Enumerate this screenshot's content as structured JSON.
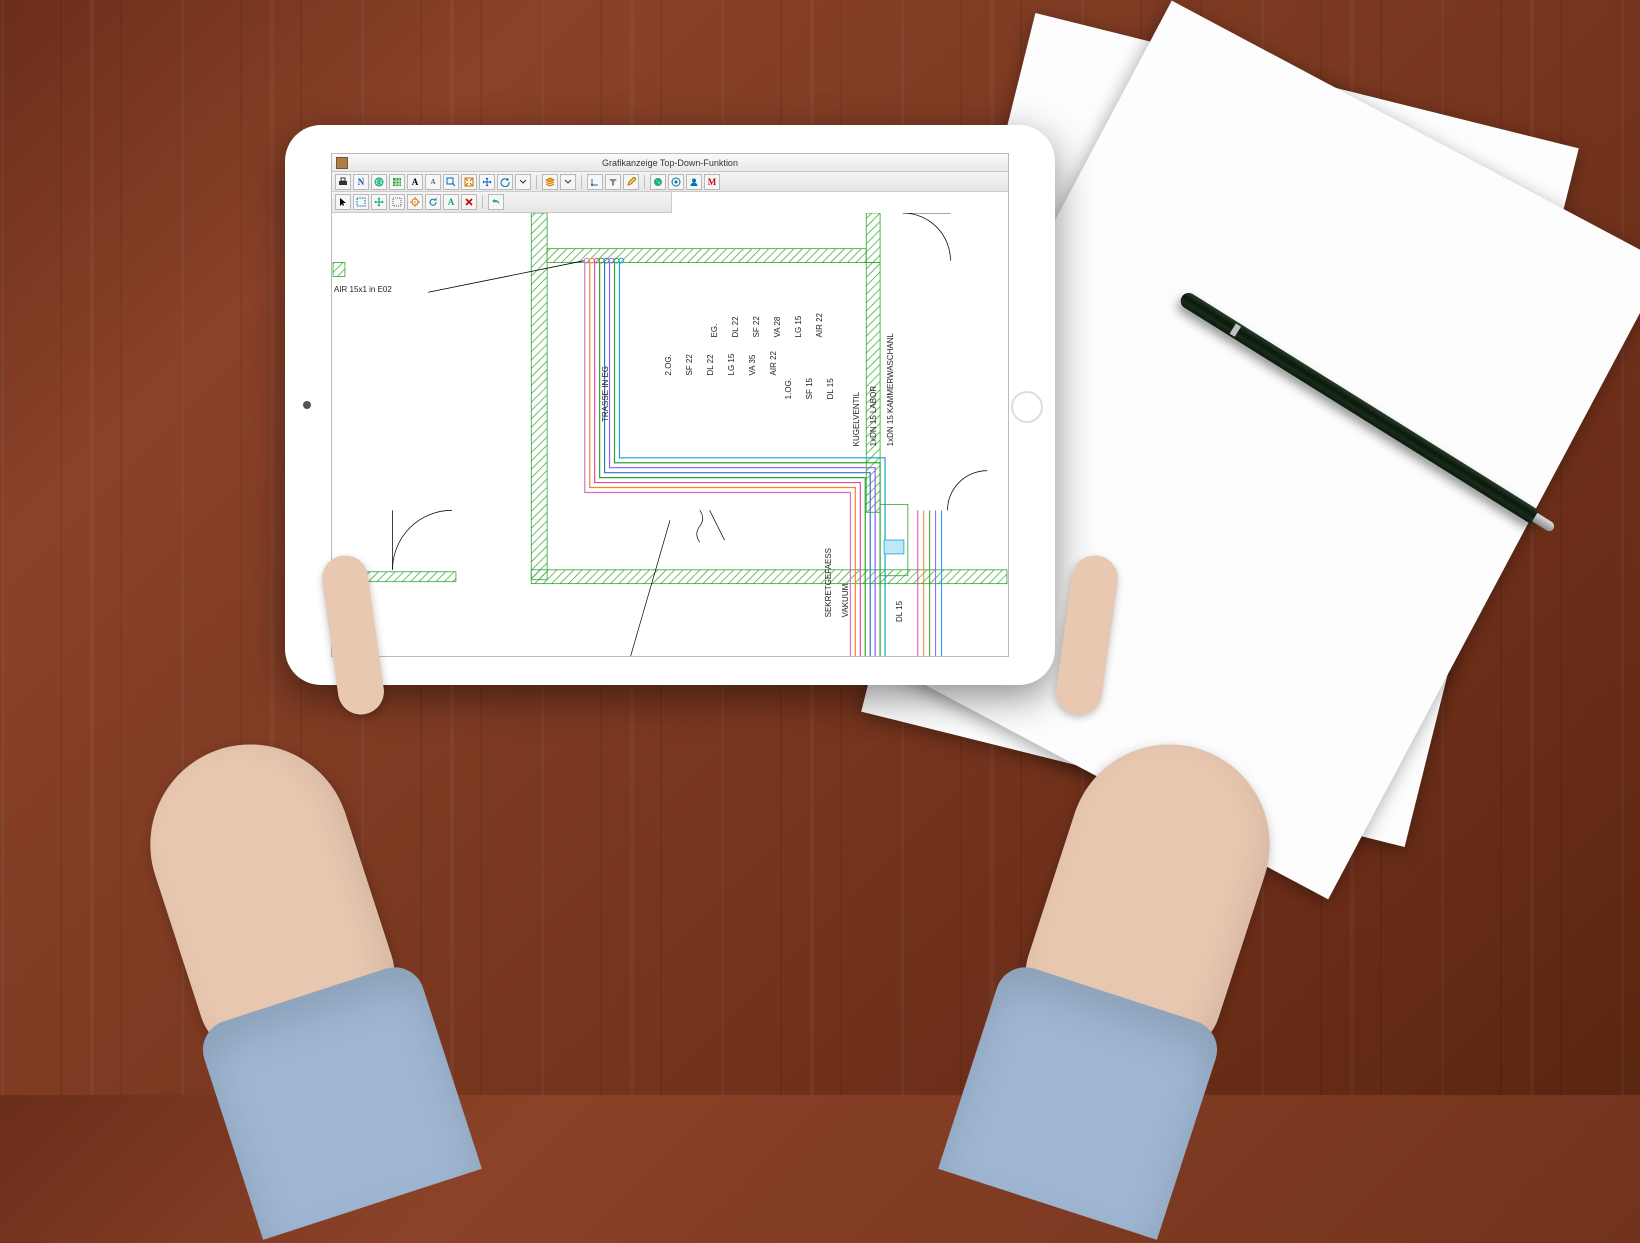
{
  "window": {
    "title": "Grafikanzeige Top-Down-Funktion"
  },
  "toolbar1": [
    {
      "name": "print-icon",
      "glyph": "printer"
    },
    {
      "name": "north-icon",
      "text": "N",
      "cls": "txt",
      "color": "#1558b0"
    },
    {
      "name": "globe-icon",
      "glyph": "globe"
    },
    {
      "name": "grid-icon",
      "glyph": "grid"
    },
    {
      "name": "zoom-in-icon",
      "text": "A",
      "cls": "txt",
      "color": "#000"
    },
    {
      "name": "zoom-out-icon",
      "text": "A",
      "cls": "txt",
      "color": "#666",
      "small": true
    },
    {
      "name": "zoom-window-icon",
      "glyph": "zoomwin"
    },
    {
      "name": "zoom-extents-icon",
      "glyph": "extents"
    },
    {
      "name": "pan-icon",
      "glyph": "pan"
    },
    {
      "name": "refresh-icon",
      "glyph": "refresh"
    },
    {
      "name": "dropdown-icon",
      "glyph": "chev"
    },
    {
      "sep": true
    },
    {
      "name": "layers-icon",
      "glyph": "layers"
    },
    {
      "name": "dropdown2-icon",
      "glyph": "chev"
    },
    {
      "sep": true
    },
    {
      "name": "axes-icon",
      "glyph": "axes"
    },
    {
      "name": "filter-icon",
      "glyph": "filter"
    },
    {
      "name": "edit-icon",
      "glyph": "pencil"
    },
    {
      "sep": true
    },
    {
      "name": "world-icon",
      "glyph": "world"
    },
    {
      "name": "target-icon",
      "glyph": "target"
    },
    {
      "name": "user-icon",
      "glyph": "user"
    },
    {
      "name": "mode-m-icon",
      "text": "M",
      "cls": "txt",
      "color": "#cc0018"
    }
  ],
  "toolbar2": [
    {
      "name": "cursor-icon",
      "glyph": "cursor"
    },
    {
      "name": "select-rect-icon",
      "glyph": "selrect"
    },
    {
      "name": "move-icon",
      "glyph": "move"
    },
    {
      "name": "marquee-icon",
      "glyph": "marquee"
    },
    {
      "name": "center-icon",
      "glyph": "center"
    },
    {
      "name": "rotate-icon",
      "glyph": "rotate"
    },
    {
      "name": "measure-icon",
      "text": "A",
      "cls": "txt",
      "color": "#0a6"
    },
    {
      "name": "close-icon",
      "glyph": "x"
    },
    {
      "sep": true
    },
    {
      "name": "undo-icon",
      "glyph": "undo"
    }
  ],
  "drawing": {
    "callout_air": "AIR 15x1 in E02",
    "trasse": "TRASSE IN EG",
    "floors": {
      "og2": {
        "title": "2.OG.",
        "lines": [
          "SF 22",
          "DL 22",
          "LG 15",
          "VA 35",
          "AIR 22"
        ]
      },
      "og1": {
        "title": "1.OG.",
        "lines": [
          "SF 15",
          "DL 15"
        ]
      },
      "eg": {
        "title": "EG.",
        "lines": [
          "DL 22",
          "SF 22",
          "VA 28",
          "LG 15",
          "AIR 22"
        ]
      }
    },
    "kugelventil": {
      "title": "KUGELVENTIL",
      "line1": "1xDN 15 LABOR",
      "line2": "1xDN 15 KAMMERWASCHANL"
    },
    "sekret": {
      "title": "SEKRETGEFAESS",
      "sub": "VAKUUM"
    },
    "dl15": "DL 15",
    "pipe_colors": [
      "#d372c5",
      "#f08928",
      "#e74a9c",
      "#2aa52a",
      "#2f74d2",
      "#8b5cf6",
      "#2aa52a",
      "#14a3d6"
    ]
  }
}
